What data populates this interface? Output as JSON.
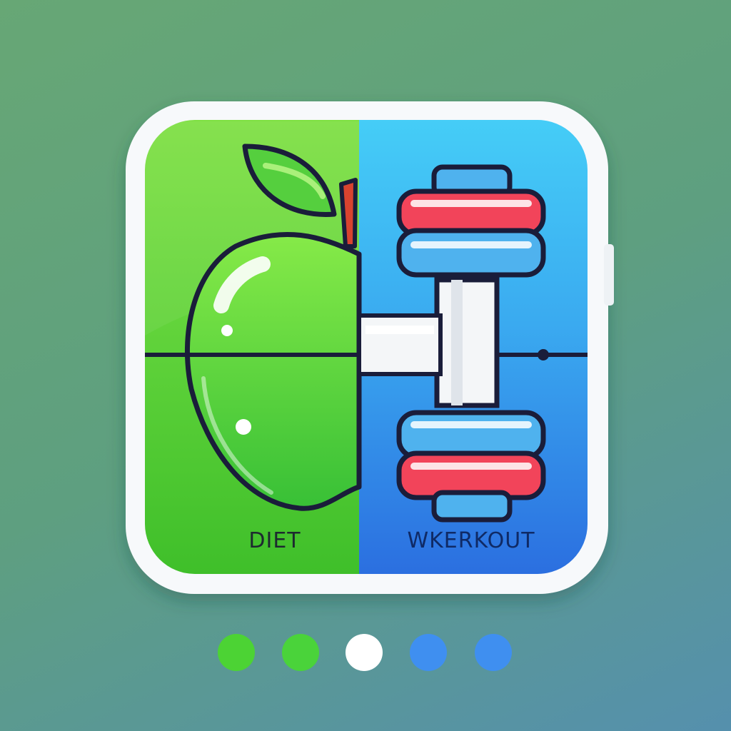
{
  "labels": {
    "left": "DIET",
    "right": "WKERKOUT"
  },
  "icons": {
    "left": "apple-icon",
    "right": "dumbbell-icon"
  },
  "colors": {
    "background": "#63a17c",
    "diet_green": "#4fd038",
    "workout_blue": "#2f8ae8",
    "accent_red": "#f2445a",
    "outline": "#1a1d3a"
  },
  "page_indicator": {
    "dots": [
      {
        "color": "#4cd334"
      },
      {
        "color": "#4ad33a"
      },
      {
        "color": "#ffffff"
      },
      {
        "color": "#3f8ff0"
      },
      {
        "color": "#3f8ff0"
      }
    ]
  }
}
